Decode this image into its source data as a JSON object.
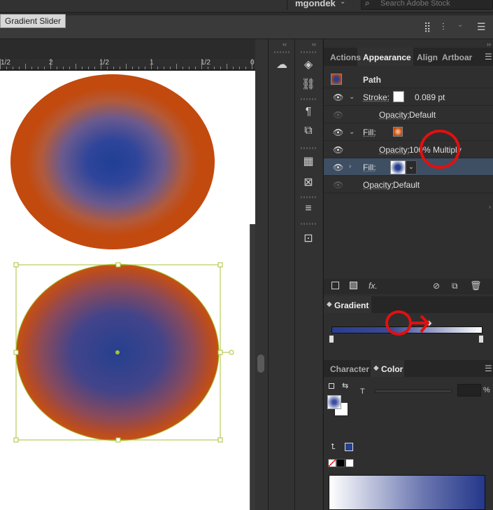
{
  "topbar": {
    "username": "mgondek",
    "search_placeholder": "Search Adobe Stock"
  },
  "tooltip": "Gradient Slider",
  "ruler": {
    "labels": [
      "1/2",
      "2",
      "1/2",
      "1",
      "1/2",
      "0"
    ]
  },
  "appearance": {
    "tabs": [
      "Actions",
      "Appearance",
      "Align",
      "Artboar"
    ],
    "active_tab": "Appearance",
    "header": "Path",
    "rows": [
      {
        "label": "Stroke:",
        "value": "0.089 pt"
      },
      {
        "label": "Opacity:",
        "value": "Default"
      },
      {
        "label": "Fill:",
        "value": ""
      },
      {
        "label": "Opacity:",
        "value": "100% Multiply"
      },
      {
        "label": "Fill:",
        "value": ""
      },
      {
        "label": "Opacity:",
        "value": "Default"
      }
    ],
    "footer_fx": "fx."
  },
  "gradient": {
    "title": "Gradient",
    "midpoint_percent": 65
  },
  "color": {
    "tabs": [
      "Character",
      "Color"
    ],
    "active_tab": "Color",
    "tint_label": "T",
    "tint_value": "",
    "percent_sign": "%"
  },
  "colors": {
    "orange": "#c24a0e",
    "blue": "#25408f",
    "selection": "#3e4e63",
    "highlight_red": "#e01010",
    "bbox": "#a8c234"
  }
}
